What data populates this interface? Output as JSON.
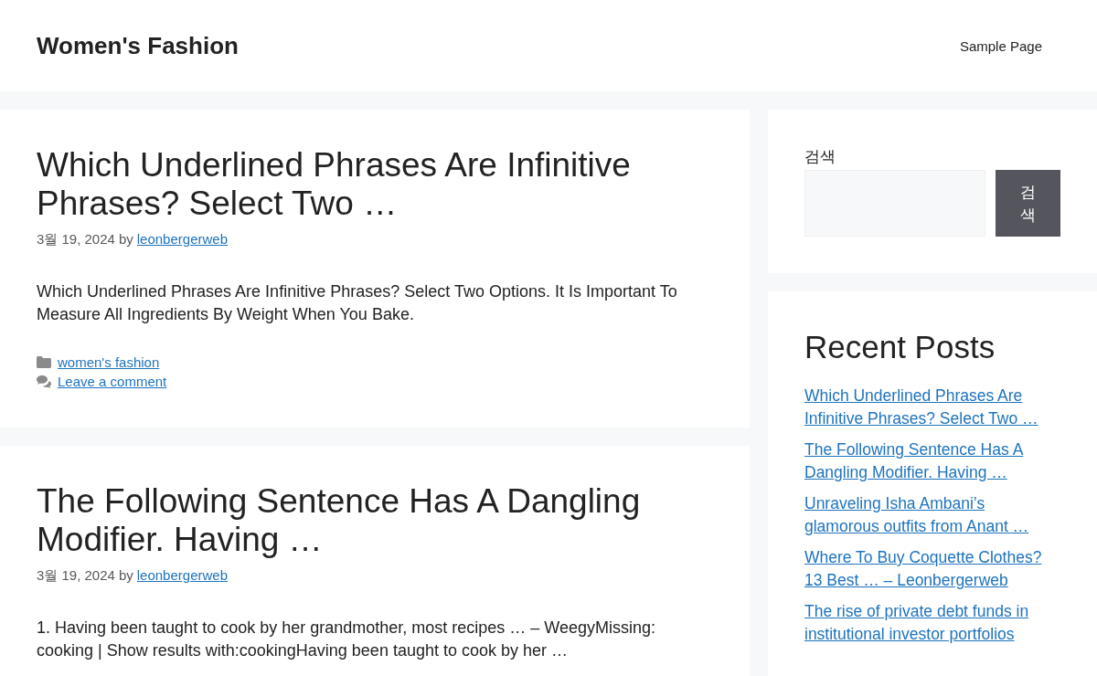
{
  "header": {
    "site_title": "Women's Fashion",
    "nav": [
      {
        "label": "Sample Page"
      }
    ]
  },
  "posts": [
    {
      "title": "Which Underlined Phrases Are Infinitive Phrases? Select Two …",
      "date": "3월 19, 2024",
      "by": "by",
      "author": "leonbergerweb",
      "excerpt": "Which Underlined Phrases Are Infinitive Phrases? Select Two Options. It Is Important To Measure All Ingredients By Weight When You Bake.",
      "category": "women's fashion",
      "comment_link": "Leave a comment"
    },
    {
      "title": "The Following Sentence Has A Dangling Modifier. Having …",
      "date": "3월 19, 2024",
      "by": "by",
      "author": "leonbergerweb",
      "excerpt": "1. Having been taught to cook by her grandmother, most recipes … – WeegyMissing: cooking | Show results with:cookingHaving been taught to cook by her …"
    }
  ],
  "sidebar": {
    "search": {
      "label": "검색",
      "button": "검색"
    },
    "recent_posts": {
      "title": "Recent Posts",
      "items": [
        "Which Underlined Phrases Are Infinitive Phrases? Select Two …",
        "The Following Sentence Has A Dangling Modifier. Having …",
        "Unraveling Isha Ambani’s glamorous outfits from Anant …",
        "Where To Buy Coquette Clothes? 13 Best … – Leonbergerweb",
        "The rise of private debt funds in institutional investor portfolios"
      ]
    }
  }
}
